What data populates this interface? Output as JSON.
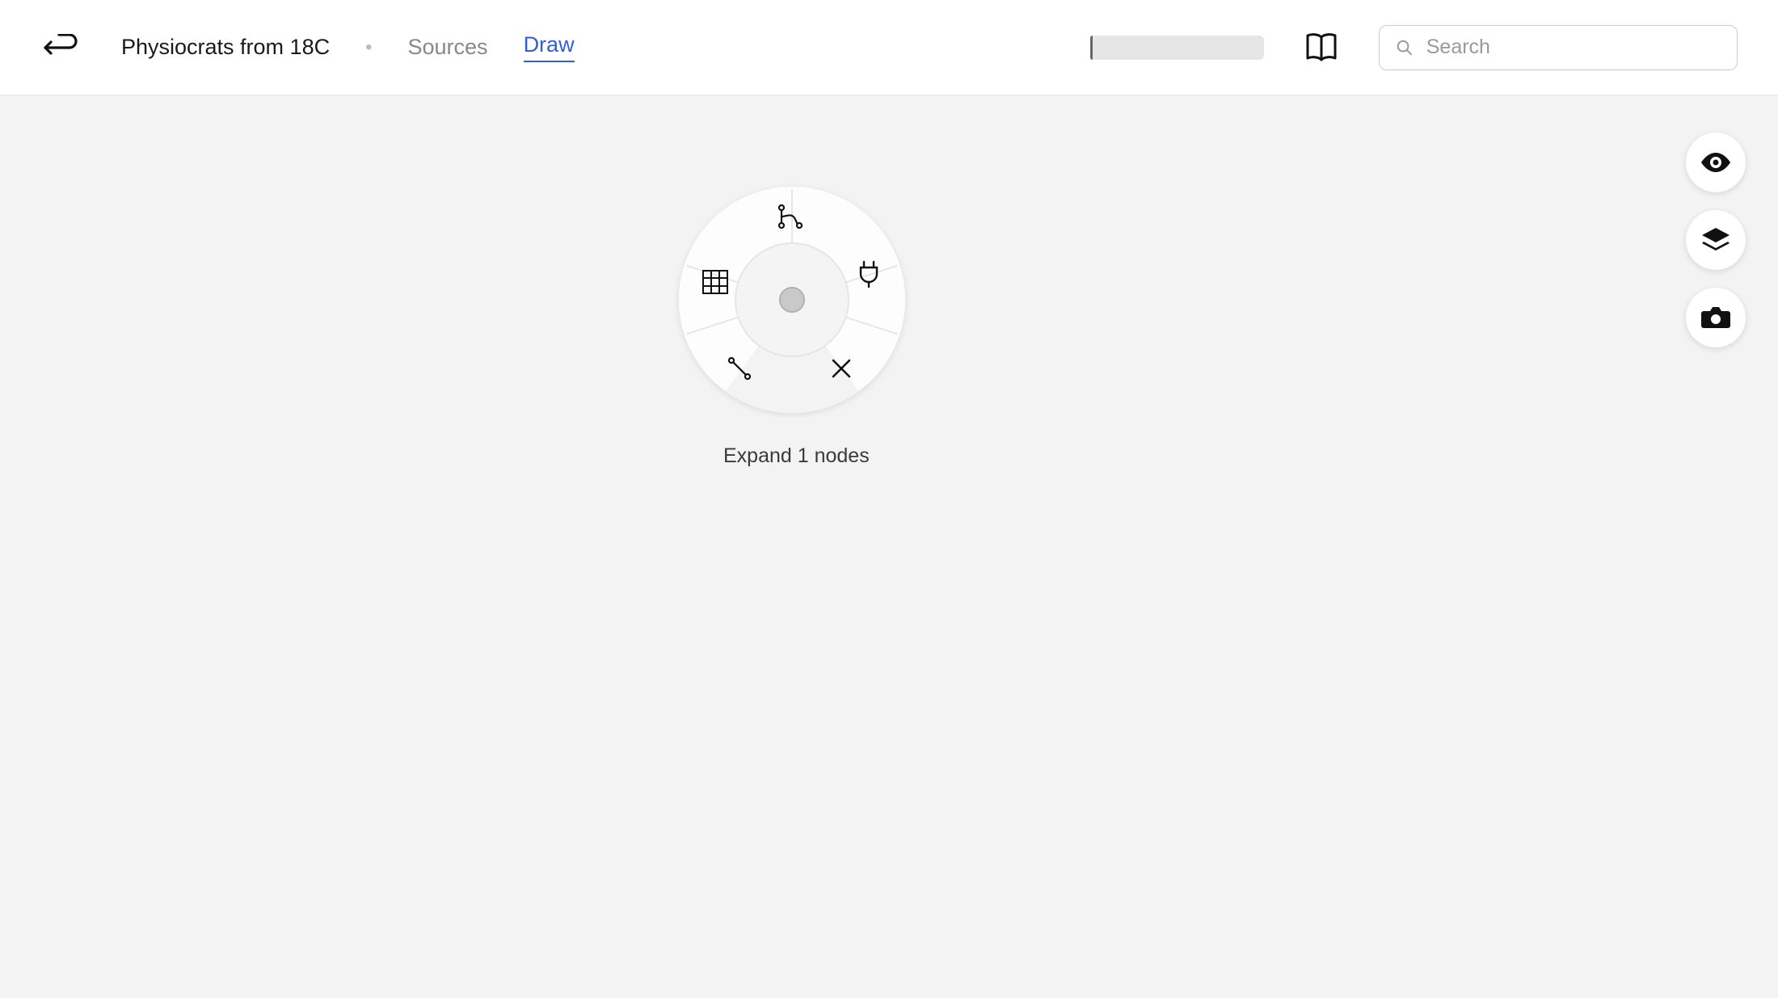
{
  "header": {
    "title": "Physiocrats from 18C",
    "tabs": [
      {
        "label": "Sources",
        "active": false
      },
      {
        "label": "Draw",
        "active": true
      }
    ]
  },
  "search": {
    "placeholder": "Search"
  },
  "radial": {
    "caption": "Expand 1 nodes"
  },
  "right_tools": [
    {
      "id": "visibility",
      "icon": "eye-icon"
    },
    {
      "id": "layers",
      "icon": "layers-icon"
    },
    {
      "id": "snapshot",
      "icon": "camera-icon"
    }
  ],
  "radial_items": [
    {
      "id": "table",
      "icon": "table-icon"
    },
    {
      "id": "branch",
      "icon": "branch-icon"
    },
    {
      "id": "plugin",
      "icon": "plug-icon"
    },
    {
      "id": "close",
      "icon": "close-icon"
    },
    {
      "id": "connect",
      "icon": "connect-icon"
    }
  ]
}
